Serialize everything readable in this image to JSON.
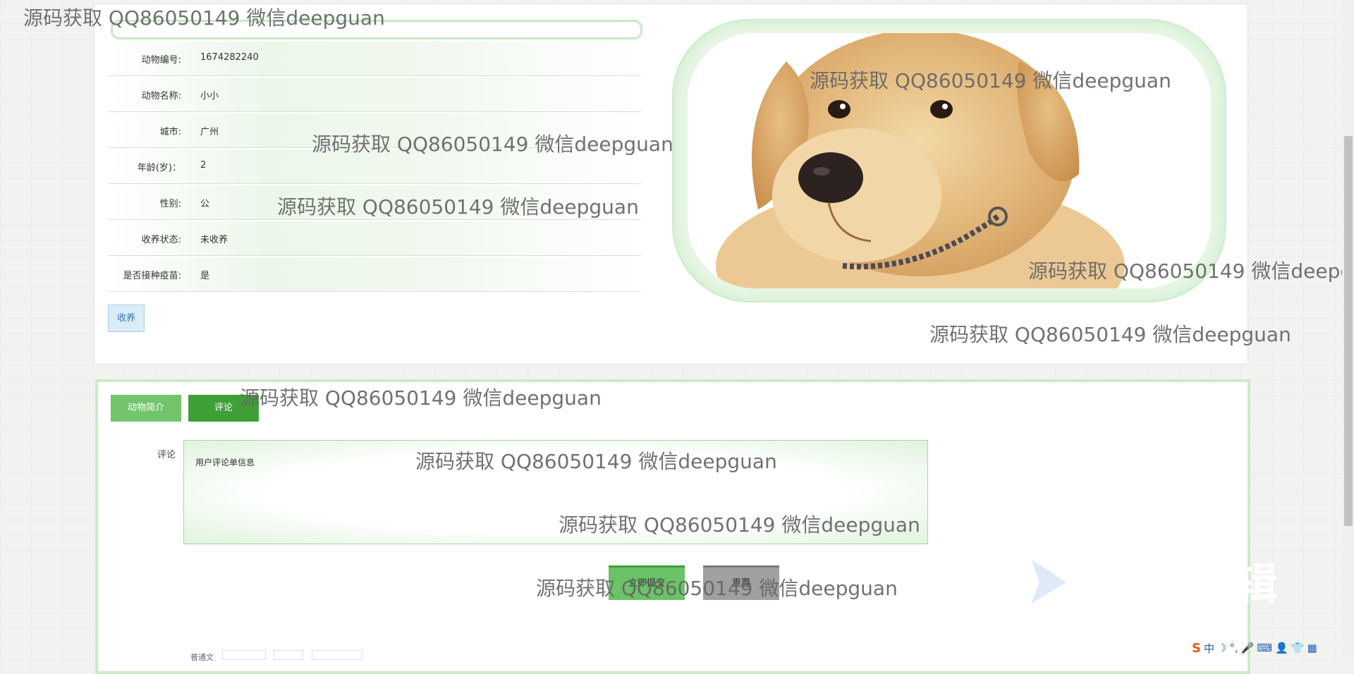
{
  "animal": {
    "fields": [
      {
        "label": "动物编号:",
        "value": "1674282240"
      },
      {
        "label": "动物名称:",
        "value": "小小"
      },
      {
        "label": "城市:",
        "value": "广州"
      },
      {
        "label": "年龄(岁)：",
        "value": "2"
      },
      {
        "label": "性别:",
        "value": "公"
      },
      {
        "label": "收养状态:",
        "value": "未收养"
      },
      {
        "label": "是否接种疫苗:",
        "value": "是"
      }
    ],
    "adopt_button": "收养"
  },
  "tabs": {
    "intro": "动物简介",
    "comment": "评论"
  },
  "comment_form": {
    "label": "评论",
    "text": "用户评论单信息",
    "submit": "立即提交",
    "reset": "重置"
  },
  "editor_toolbar": {
    "left_label": "普通文"
  },
  "overlay": {
    "watermark": "源码获取 QQ86050149 微信deepguan",
    "corner_text": "辑"
  },
  "taskbar_ime": {
    "items": [
      "S",
      "中",
      "☽",
      "°,",
      "🎤",
      "⌨",
      "👤",
      "👕",
      "▦"
    ]
  },
  "colors": {
    "tab_intro": "#72c46b",
    "tab_comment": "#3f9f37",
    "submit_green": "#6cc267",
    "reset_gray": "#a0a0a0",
    "frame_green": "#cdeccb"
  }
}
